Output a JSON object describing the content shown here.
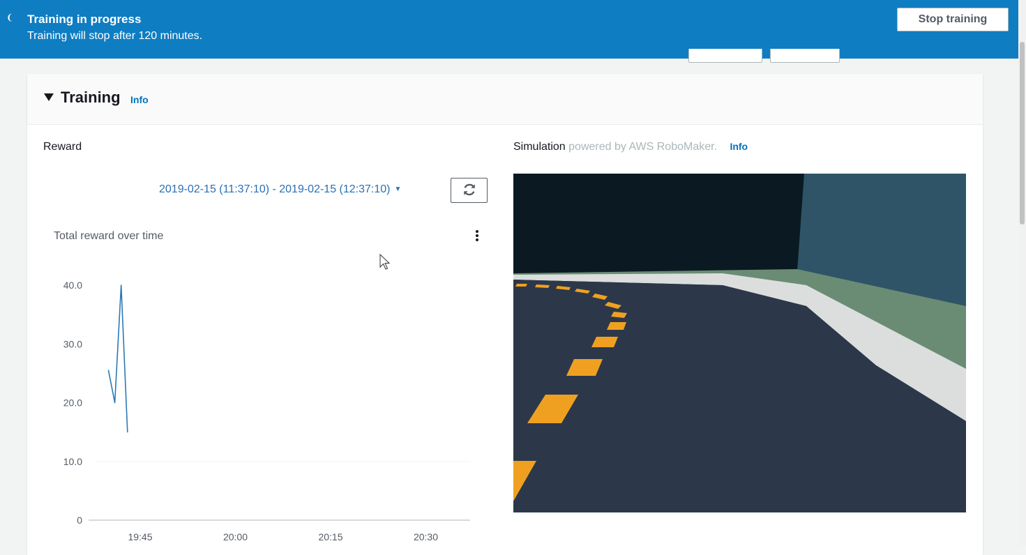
{
  "banner": {
    "title": "Training in progress",
    "subtitle": "Training will stop after 120 minutes.",
    "stop_label": "Stop training"
  },
  "section": {
    "title": "Training",
    "info": "Info"
  },
  "reward": {
    "label": "Reward",
    "date_range": "2019-02-15 (11:37:10) - 2019-02-15 (12:37:10)",
    "chart_title": "Total reward over time"
  },
  "simulation": {
    "label": "Simulation",
    "powered_by": "powered by AWS RoboMaker.",
    "info": "Info"
  },
  "colors": {
    "banner": "#0f7dc2",
    "line": "#2a7ab5",
    "link": "#0073bb"
  },
  "chart_data": {
    "type": "line",
    "title": "Total reward over time",
    "ylim": [
      0,
      40
    ],
    "yticks": [
      "0",
      "10.0",
      "20.0",
      "30.0",
      "40.0"
    ],
    "y_tick_values": [
      0,
      10,
      20,
      30,
      40
    ],
    "xticks": [
      "19:45",
      "20:00",
      "20:15",
      "20:30"
    ],
    "x_tick_minutes": [
      0,
      15,
      30,
      45
    ],
    "series": [
      {
        "x_minutes": [
          -5,
          -4,
          -3,
          -2
        ],
        "values": [
          25.5,
          20.0,
          40.0,
          15.0
        ]
      }
    ]
  }
}
